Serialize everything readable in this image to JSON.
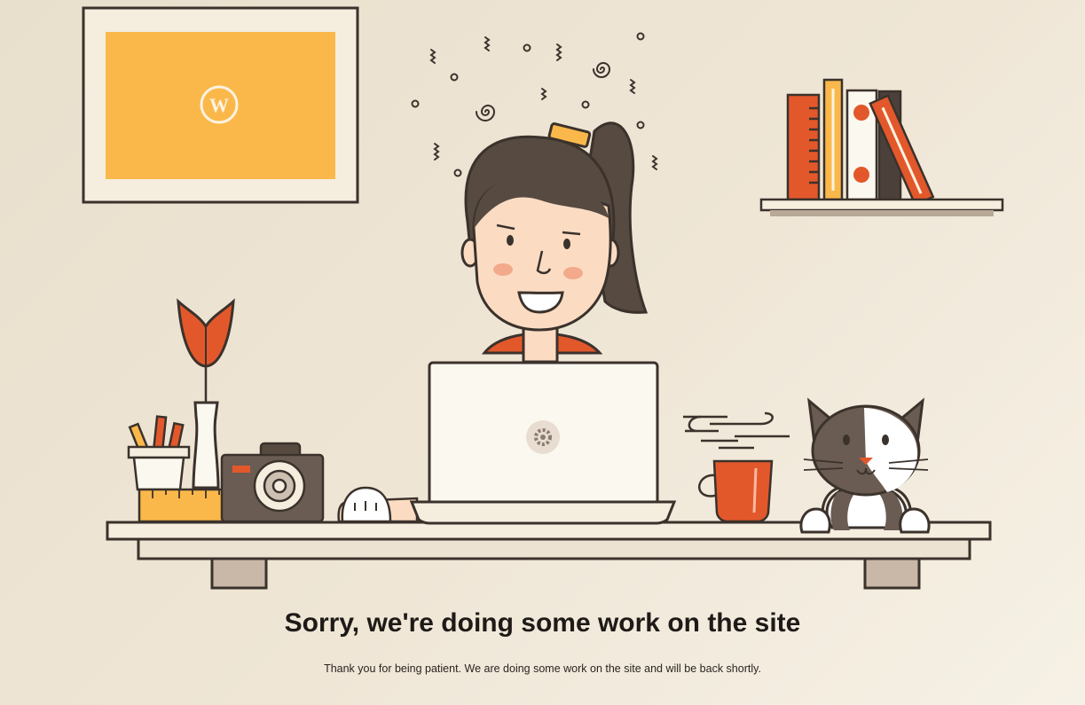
{
  "page": {
    "heading": "Sorry, we're doing some work on the site",
    "message": "Thank you for being patient. We are doing some work on the site and will be back shortly."
  },
  "illustration": {
    "frame_logo": "wordpress-logo",
    "laptop_logo": "gear-icon",
    "colors": {
      "outline": "#3b322c",
      "orange": "#e2582b",
      "yellow": "#fbb84a",
      "hair": "#574a40",
      "skin": "#fbdcc3",
      "cream": "#f7f1e4"
    }
  }
}
